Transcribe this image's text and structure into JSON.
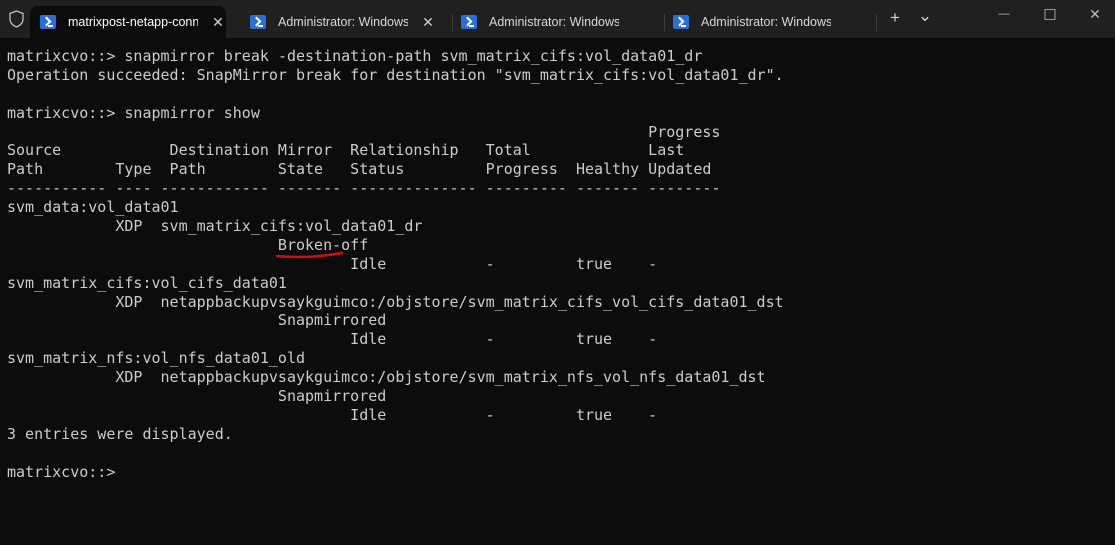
{
  "tabs": [
    {
      "label": "matrixpost-netapp-conn",
      "active": true
    },
    {
      "label": "Administrator: Windows P",
      "active": false
    },
    {
      "label": "Administrator: Windows P",
      "active": false
    },
    {
      "label": "Administrator: Windows P",
      "active": false
    }
  ],
  "tab_close": "✕",
  "new_tab": "+",
  "dropdown": "⌄",
  "window": {
    "minimize": "—",
    "maximize": "☐",
    "close": "✕"
  },
  "annotation_color": "#d01010",
  "terminal_lines": [
    "matrixcvo::> snapmirror break -destination-path svm_matrix_cifs:vol_data01_dr",
    "Operation succeeded: SnapMirror break for destination \"svm_matrix_cifs:vol_data01_dr\".",
    "",
    "matrixcvo::> snapmirror show",
    "                                                                       Progress",
    "Source            Destination Mirror  Relationship   Total             Last",
    "Path        Type  Path        State   Status         Progress  Healthy Updated",
    "----------- ---- ------------ ------- -------------- --------- ------- --------",
    "svm_data:vol_data01",
    "            XDP  svm_matrix_cifs:vol_data01_dr",
    "                              Broken-off",
    "                                      Idle           -         true    -",
    "svm_matrix_cifs:vol_cifs_data01",
    "            XDP  netappbackupvsaykguimco:/objstore/svm_matrix_cifs_vol_cifs_data01_dst",
    "                              Snapmirrored",
    "                                      Idle           -         true    -",
    "svm_matrix_nfs:vol_nfs_data01_old",
    "            XDP  netappbackupvsaykguimco:/objstore/svm_matrix_nfs_vol_nfs_data01_dst",
    "                              Snapmirrored",
    "                                      Idle           -         true    -",
    "3 entries were displayed.",
    "",
    "matrixcvo::>"
  ]
}
